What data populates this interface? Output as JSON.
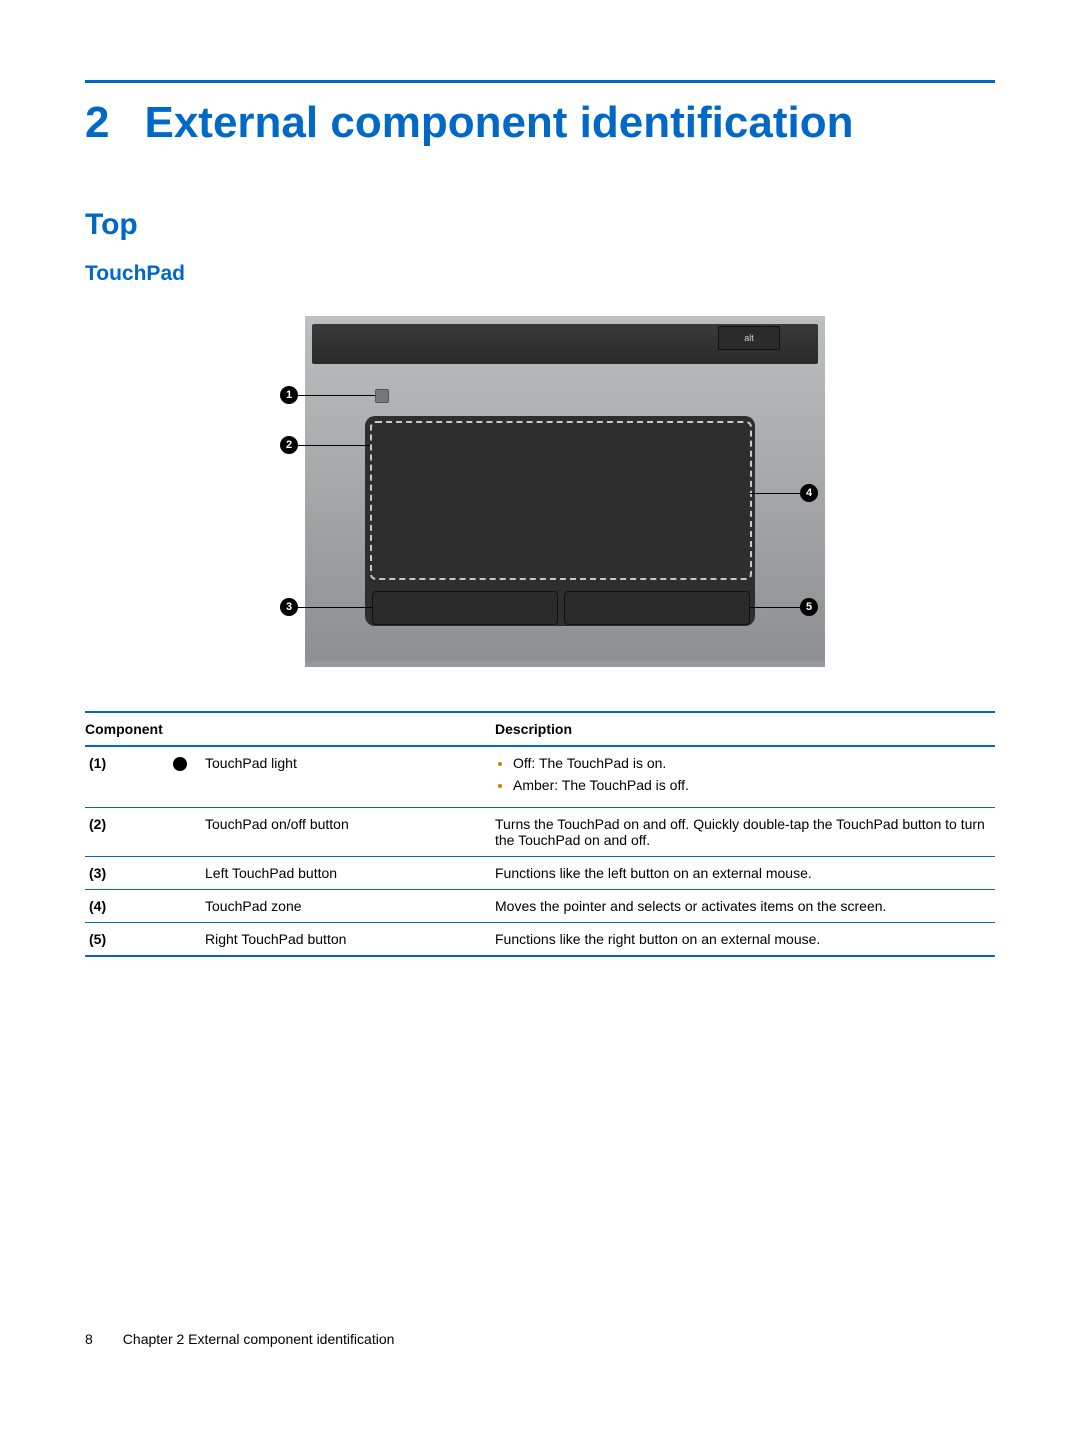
{
  "chapter": {
    "number": "2",
    "title": "External component identification"
  },
  "section": "Top",
  "subsection": "TouchPad",
  "diagram": {
    "alt_key": "alt"
  },
  "callouts": {
    "c1": "1",
    "c2": "2",
    "c3": "3",
    "c4": "4",
    "c5": "5"
  },
  "table": {
    "head_component": "Component",
    "head_description": "Description",
    "rows": [
      {
        "num": "(1)",
        "icon": "light-dot",
        "name": "TouchPad light",
        "desc_list": [
          "Off: The TouchPad is on.",
          "Amber: The TouchPad is off."
        ]
      },
      {
        "num": "(2)",
        "name": "TouchPad on/off button",
        "desc": "Turns the TouchPad on and off. Quickly double-tap the TouchPad button to turn the TouchPad on and off."
      },
      {
        "num": "(3)",
        "name": "Left TouchPad button",
        "desc": "Functions like the left button on an external mouse."
      },
      {
        "num": "(4)",
        "name": "TouchPad zone",
        "desc": "Moves the pointer and selects or activates items on the screen."
      },
      {
        "num": "(5)",
        "name": "Right TouchPad button",
        "desc": "Functions like the right button on an external mouse."
      }
    ]
  },
  "footer": {
    "page": "8",
    "text": "Chapter 2   External component identification"
  }
}
